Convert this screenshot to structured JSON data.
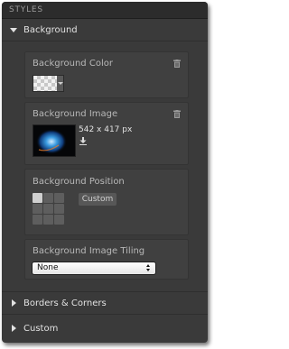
{
  "panel": {
    "title": "STYLES"
  },
  "sections": {
    "background": {
      "label": "Background",
      "expanded": true
    },
    "borders": {
      "label": "Borders & Corners",
      "expanded": false
    },
    "custom": {
      "label": "Custom",
      "expanded": false
    }
  },
  "background_color": {
    "label": "Background Color",
    "value": "transparent"
  },
  "background_image": {
    "label": "Background Image",
    "dimensions": "542 x 417 px"
  },
  "background_position": {
    "label": "Background Position",
    "selected_cell": "top-left",
    "custom_label": "Custom"
  },
  "background_tiling": {
    "label": "Background Image Tiling",
    "selected": "None"
  },
  "colors": {
    "panel_bg": "#3a3a3a",
    "card_bg": "#404040",
    "text_light": "#e2e2e2",
    "text_muted": "#b8b8b8"
  },
  "icons": {
    "trash": "trash-icon",
    "download": "download-icon",
    "expand": "triangle-down-icon",
    "collapse": "triangle-right-icon"
  }
}
